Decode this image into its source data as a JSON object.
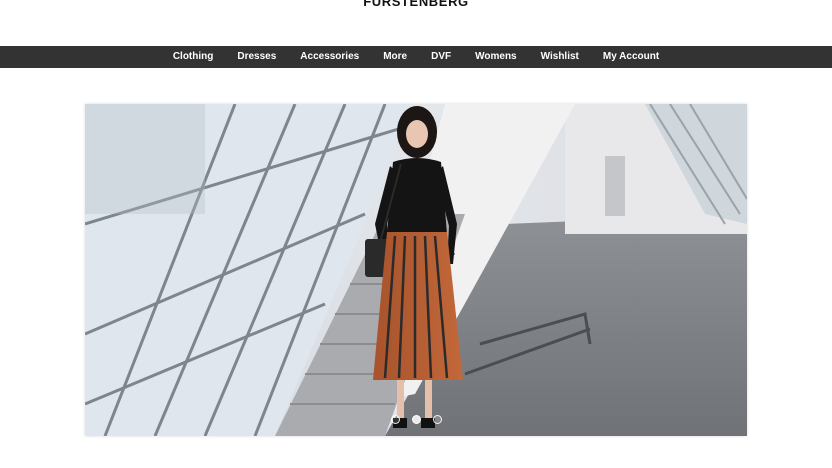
{
  "brand": {
    "name": "FURSTENBERG"
  },
  "nav": {
    "items": [
      {
        "label": "Clothing"
      },
      {
        "label": "Dresses"
      },
      {
        "label": "Accessories"
      },
      {
        "label": "More"
      },
      {
        "label": "DVF"
      },
      {
        "label": "Womens"
      },
      {
        "label": "Wishlist"
      },
      {
        "label": "My Account"
      }
    ]
  },
  "carousel": {
    "slide_count": 3,
    "active_index": 1
  },
  "colors": {
    "nav_bg": "#333333",
    "nav_text": "#ffffff",
    "page_bg": "#ffffff"
  }
}
